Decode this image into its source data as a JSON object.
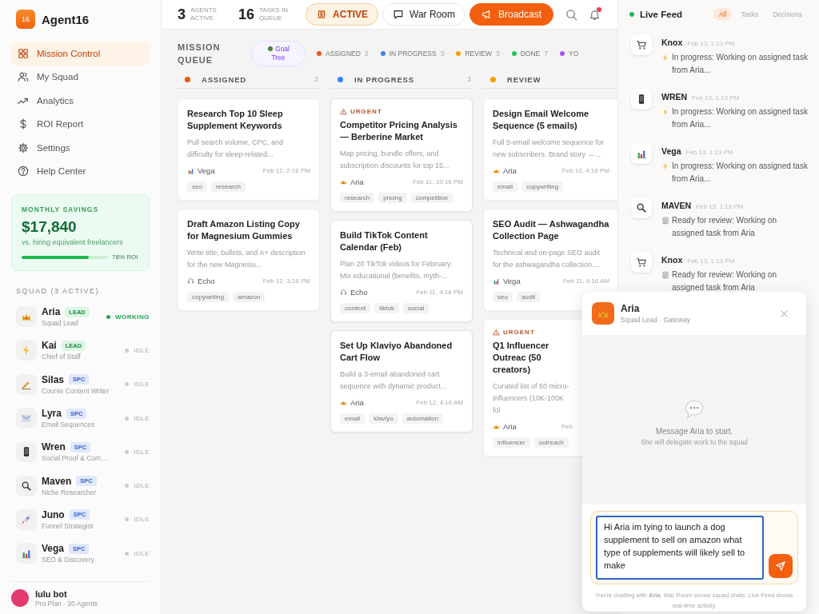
{
  "brand": {
    "logo": "16",
    "name": "Agent16"
  },
  "nav": [
    {
      "label": "Mission Control",
      "selected": true
    },
    {
      "label": "My Squad",
      "selected": false
    },
    {
      "label": "Analytics",
      "selected": false
    },
    {
      "label": "ROI Report",
      "selected": false
    },
    {
      "label": "Settings",
      "selected": false
    },
    {
      "label": "Help Center",
      "selected": false
    }
  ],
  "savings": {
    "label": "MONTHLY SAVINGS",
    "amount": "$17,840",
    "note": "vs. hiring equivalent freelancers",
    "level": 0.78,
    "reading": "78% ROI"
  },
  "squad": {
    "title": "SQUAD (3 ACTIVE)",
    "members": [
      {
        "name": "Aria",
        "badge": "LEAD",
        "role": "Squad Lead",
        "status": "WORKING",
        "working": true
      },
      {
        "name": "Kai",
        "badge": "LEAD",
        "role": "Chief of Staff",
        "status": "IDLE",
        "working": false
      },
      {
        "name": "Silas",
        "badge": "SPC",
        "role": "Course Content Writer",
        "status": "IDLE",
        "working": false
      },
      {
        "name": "Lyra",
        "badge": "SPC",
        "role": "Email Sequences",
        "status": "IDLE",
        "working": false
      },
      {
        "name": "Wren",
        "badge": "SPC",
        "role": "Social Proof & Com…",
        "status": "IDLE",
        "working": false
      },
      {
        "name": "Maven",
        "badge": "SPC",
        "role": "Niche Researcher",
        "status": "IDLE",
        "working": false
      },
      {
        "name": "Juno",
        "badge": "SPC",
        "role": "Funnel Strategist",
        "status": "IDLE",
        "working": false
      },
      {
        "name": "Vega",
        "badge": "SPC",
        "role": "SEO & Discovery",
        "status": "IDLE",
        "working": false
      }
    ]
  },
  "user": {
    "name": "lulu bot",
    "plan": "Pro Plan · 20 Agents"
  },
  "topbar": {
    "stats": [
      {
        "value": "3",
        "label": "AGENTS ACTIVE"
      },
      {
        "value": "16",
        "label": "TASKS IN QUEUE"
      }
    ],
    "buttons": [
      {
        "label": "ACTIVE",
        "kind": "toggle"
      },
      {
        "label": "War Room",
        "kind": "outline"
      },
      {
        "label": "Broadcast",
        "kind": "primary"
      }
    ],
    "notification": true
  },
  "queue": {
    "title": "MISSION QUEUE",
    "goal_tree": "Goal Tree",
    "filters": [
      {
        "label": "ASSIGNED",
        "count": "2",
        "color": "#ea580c"
      },
      {
        "label": "IN PROGRESS",
        "count": "3",
        "color": "#3b82f6"
      },
      {
        "label": "REVIEW",
        "count": "3",
        "color": "#f59e0b"
      },
      {
        "label": "DONE",
        "count": "7",
        "color": "#22c55e"
      },
      {
        "label": "YO",
        "color": "#a855f7"
      }
    ],
    "columns": [
      {
        "name": "ASSIGNED",
        "count": "2",
        "color": "#ea580c",
        "cards": [
          {
            "title": "Research Top 10 Sleep Supplement Keywords",
            "desc": "Pull search volume, CPC, and difficulty for sleep-related...",
            "agent": "Vega",
            "date": "Feb 12, 2:16 PM",
            "tags": [
              "seo",
              "research"
            ]
          },
          {
            "title": "Draft Amazon Listing Copy for Magnesium Gummies",
            "desc": "Write title, bullets, and A+ description for the new Magnesiu...",
            "agent": "Echo",
            "date": "Feb 12, 3:16 PM",
            "tags": [
              "copywriting",
              "amazon"
            ]
          }
        ]
      },
      {
        "name": "IN PROGRESS",
        "count": "3",
        "color": "#3b82f6",
        "cards": [
          {
            "flag": "URGENT",
            "title": "Competitor Pricing Analysis — Berberine Market",
            "desc": "Map pricing, bundle offers, and subscription discounts for top 15...",
            "agent": "Aria",
            "date": "Feb 11, 10:16 PM",
            "tags": [
              "research",
              "pricing",
              "competitive"
            ]
          },
          {
            "title": "Build TikTok Content Calendar (Feb)",
            "desc": "Plan 20 TikTok videos for February. Mix educational (benefits, myth-...",
            "agent": "Echo",
            "date": "Feb 11, 4:16 PM",
            "tags": [
              "content",
              "tiktok",
              "social"
            ]
          },
          {
            "title": "Set Up Klaviyo Abandoned Cart Flow",
            "desc": "Build a 3-email abandoned cart sequence with dynamic product...",
            "agent": "Aria",
            "date": "Feb 12, 4:16 AM",
            "tags": [
              "email",
              "klaviyo",
              "automation"
            ]
          }
        ]
      },
      {
        "name": "REVIEW",
        "color": "#f59e0b",
        "cards": [
          {
            "title": "Design Email Welcome Sequence (5 emails)",
            "desc": "Full 5-email welcome sequence for new subscribers. Brand story →...",
            "agent": "Aria",
            "date": "Feb 10, 4:16 PM",
            "tags": [
              "email",
              "copywriting"
            ]
          },
          {
            "title": "SEO Audit — Ashwagandha Collection Page",
            "desc": "Technical and on-page SEO audit for the ashwagandha collection....",
            "agent": "Vega",
            "date": "Feb 11, 4:16 AM",
            "tags": [
              "seo",
              "audit"
            ]
          },
          {
            "flag": "URGENT",
            "title": "Q1 Influencer Outreac (50 creators)",
            "desc": "Curated list of 50 micro- influencers (10K-100K fol",
            "agent": "Aria",
            "date": "Feb",
            "tags": [
              "influencer",
              "outreach"
            ]
          }
        ]
      }
    ]
  },
  "feed": {
    "title": "Live Feed",
    "tabs": [
      {
        "label": "All",
        "selected": true
      },
      {
        "label": "Tasks",
        "selected": false
      },
      {
        "label": "Decisions",
        "selected": false
      }
    ],
    "items": [
      {
        "name": "Knox",
        "time": "Feb 13, 1:13 PM",
        "kind": "progress",
        "text": "In progress: Working on assigned task from Aria..."
      },
      {
        "name": "WREN",
        "time": "Feb 13, 1:13 PM",
        "kind": "progress",
        "text": "In progress: Working on assigned task from Aria..."
      },
      {
        "name": "Vega",
        "time": "Feb 13, 1:13 PM",
        "kind": "progress",
        "text": "In progress: Working on assigned task from Aria..."
      },
      {
        "name": "MAVEN",
        "time": "Feb 13, 1:13 PM",
        "kind": "review",
        "text": "Ready for review: Working on assigned task from Aria"
      },
      {
        "name": "Knox",
        "time": "Feb 13, 1:13 PM",
        "kind": "review",
        "text": "Ready for review: Working on assigned task from Aria"
      }
    ]
  },
  "chat": {
    "name": "Aria",
    "subtitle": "Squad Lead · Gateway",
    "empty_title": "Message Aria to start.",
    "empty_note": "She will delegate work to the squad",
    "message": "Hi Aria im tying to launch a dog supplement to sell on amazon what type of supplements will likely sell to make",
    "footer": "You're chatting with **Aria**. War Room shows squad chats. Live Feed shows real-time activity."
  }
}
